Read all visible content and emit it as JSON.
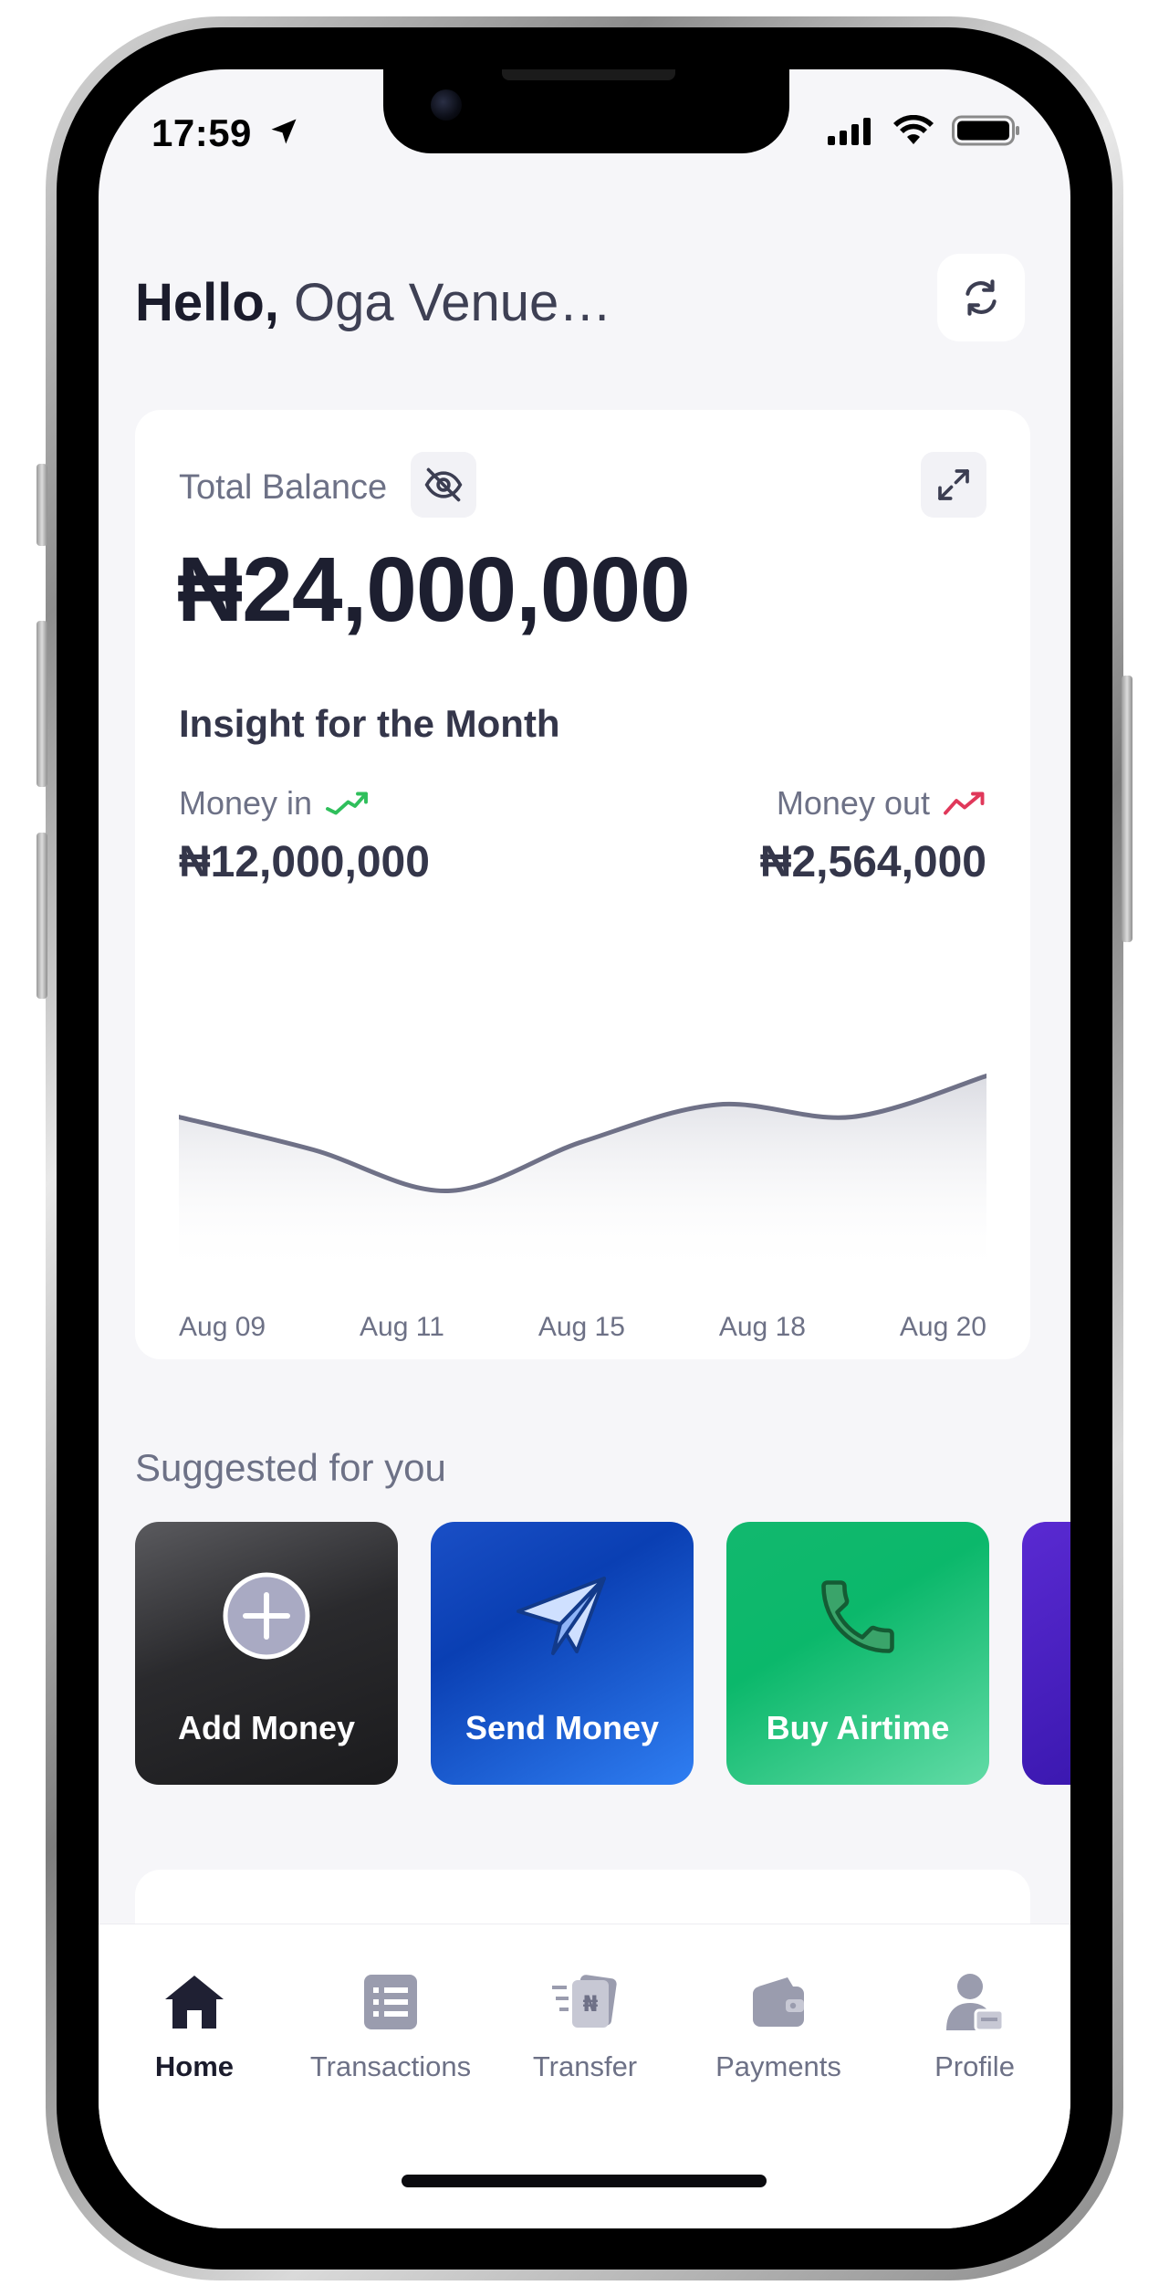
{
  "status_bar": {
    "time": "17:59"
  },
  "header": {
    "greeting_bold": "Hello,",
    "greeting_name": "Oga Venue…"
  },
  "balance": {
    "label": "Total Balance",
    "amount": "₦24,000,000"
  },
  "insight": {
    "title": "Insight for the Month",
    "money_in_label": "Money in",
    "money_in_value": "₦12,000,000",
    "money_out_label": "Money out",
    "money_out_value": "₦2,564,000"
  },
  "chart_data": {
    "type": "area",
    "x": [
      "Aug 09",
      "Aug 11",
      "Aug 15",
      "Aug 18",
      "Aug 20"
    ],
    "series": [
      {
        "values": [
          0.58,
          0.42,
          0.22,
          0.46,
          0.64,
          0.58,
          0.78
        ]
      }
    ],
    "grid": false,
    "colors": {
      "line": "#6f7187",
      "fill_top": "#dcdde3"
    }
  },
  "suggestions": {
    "title": "Suggested for you",
    "items": [
      {
        "label": "Add Money",
        "icon": "plus-circle-icon"
      },
      {
        "label": "Send Money",
        "icon": "paper-plane-icon"
      },
      {
        "label": "Buy Airtime",
        "icon": "phone-icon"
      }
    ]
  },
  "tabs": [
    {
      "label": "Home",
      "icon": "home-icon",
      "active": true
    },
    {
      "label": "Transactions",
      "icon": "list-icon",
      "active": false
    },
    {
      "label": "Transfer",
      "icon": "transfer-icon",
      "active": false
    },
    {
      "label": "Payments",
      "icon": "wallet-icon",
      "active": false
    },
    {
      "label": "Profile",
      "icon": "profile-icon",
      "active": false
    }
  ],
  "colors": {
    "accent_dark": "#1d1f30",
    "muted_text": "#6d7186",
    "trend_up": "#2fbf5b",
    "trend_down": "#e0385a"
  }
}
